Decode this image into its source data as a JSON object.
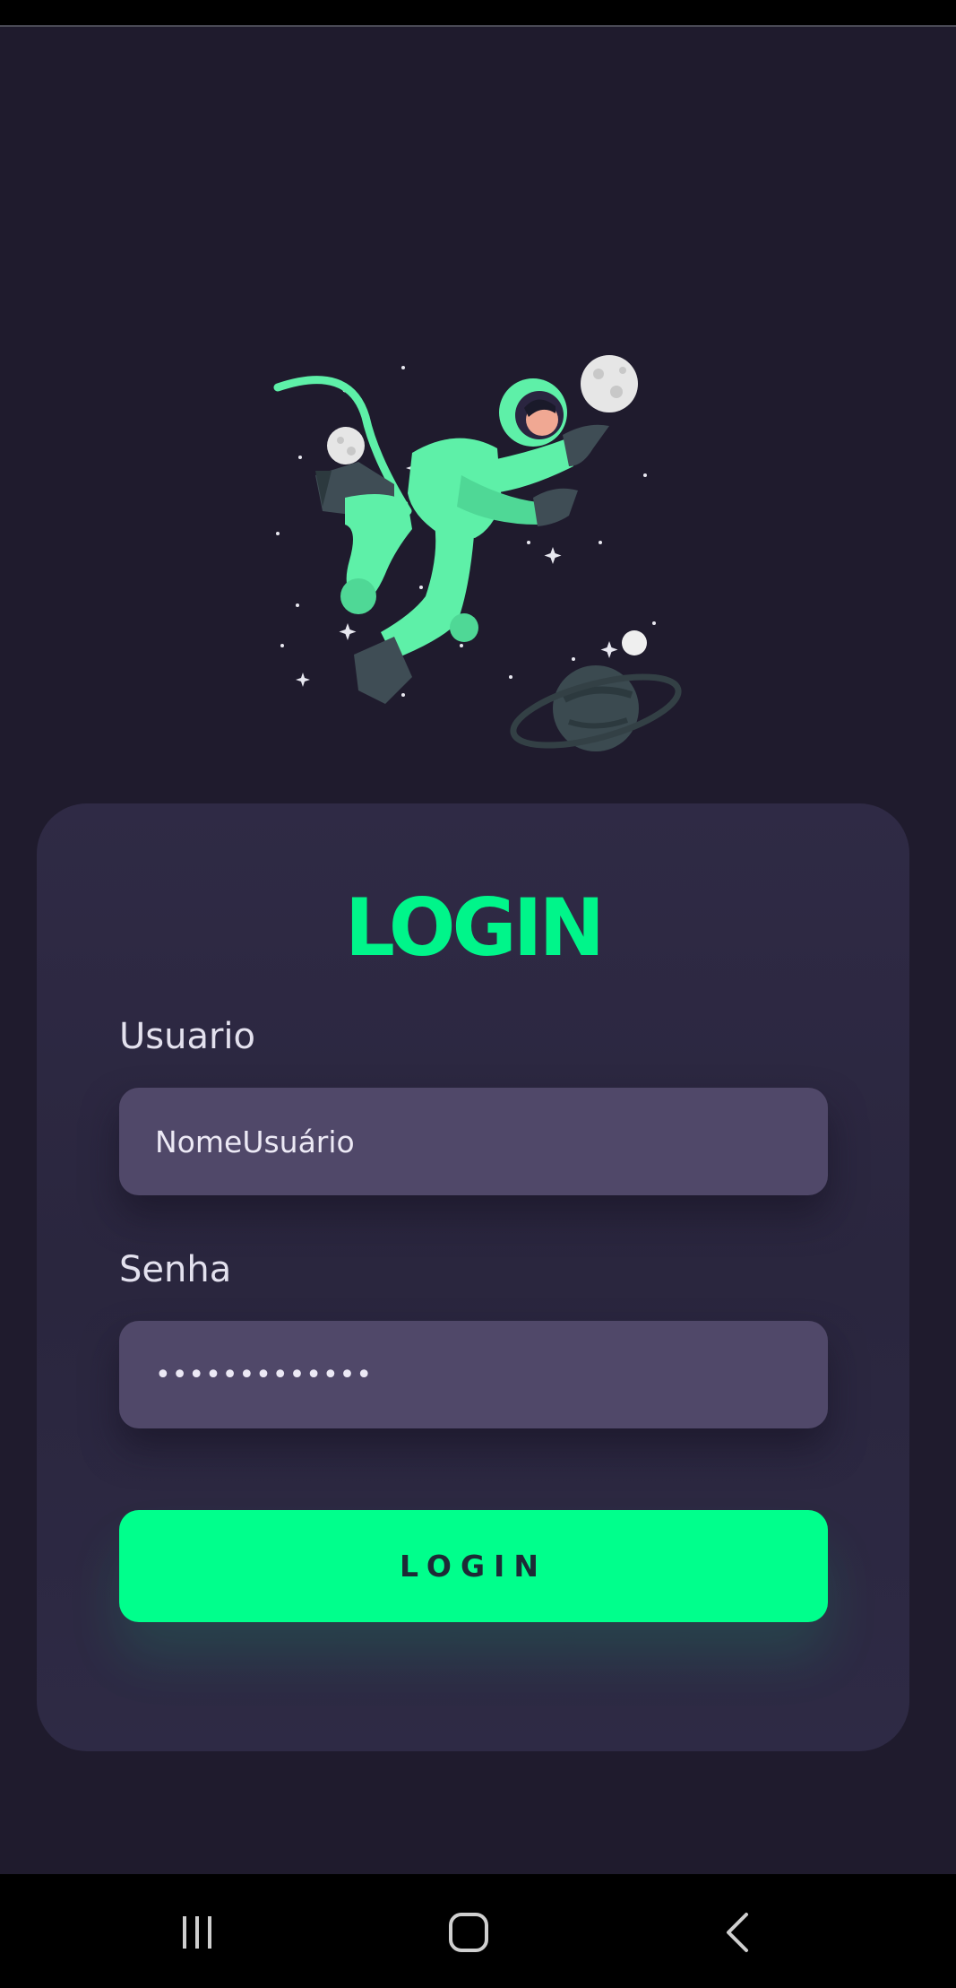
{
  "screen": {
    "title": "LOGIN"
  },
  "illustration": {
    "icon": "astronaut-illustration"
  },
  "form": {
    "username": {
      "label": "Usuario",
      "value": "NomeUsuário"
    },
    "password": {
      "label": "Senha",
      "value": "•••••••••••••"
    },
    "submit_label": "LOGIN"
  },
  "navigation": {
    "recents_icon": "recents-icon",
    "home_icon": "home-icon",
    "back_icon": "back-icon"
  },
  "colors": {
    "background": "#1f1b2d",
    "card": "#2f2a45",
    "accent": "#00ff8c",
    "input": "#504869"
  }
}
